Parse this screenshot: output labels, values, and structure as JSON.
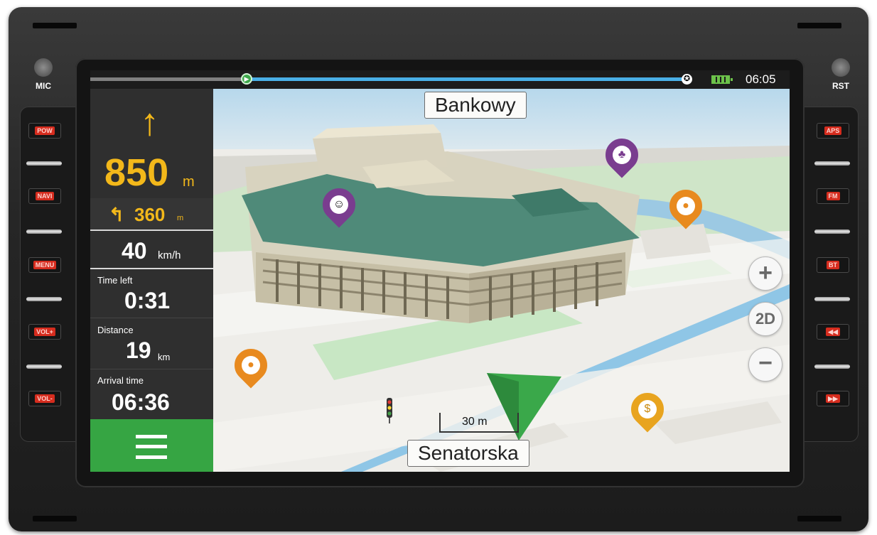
{
  "device": {
    "left_top_label": "MIC",
    "right_top_label": "RST",
    "left_buttons": [
      "POW",
      "NAVI",
      "MENU",
      "VOL+",
      "VOL-"
    ],
    "right_buttons": [
      "APS",
      "FM",
      "BT",
      "◀◀",
      "▶▶"
    ]
  },
  "status": {
    "time": "06:05",
    "route_progress_percent": 26
  },
  "maneuver": {
    "distance_value": "850",
    "distance_unit": "m",
    "next_distance_value": "360",
    "next_distance_unit": "m",
    "speed_value": "40",
    "speed_unit": "km/h"
  },
  "stats": {
    "time_left_label": "Time left",
    "time_left_value": "0:31",
    "distance_label": "Distance",
    "distance_value": "19",
    "distance_unit": "km",
    "arrival_label": "Arrival time",
    "arrival_value": "06:36"
  },
  "map": {
    "top_street": "Bankowy",
    "bottom_street": "Senatorska",
    "scale_label": "30 m",
    "view_mode": "2D",
    "pins": [
      "theater",
      "park",
      "restaurant",
      "restaurant",
      "bank"
    ]
  },
  "icons": {
    "zoom_in": "+",
    "zoom_out": "−",
    "straight": "↑",
    "turn_left": "↰",
    "start": "▶",
    "finish": "✪"
  },
  "colors": {
    "accent_yellow": "#f3b81a",
    "menu_green": "#36a543",
    "route_blue": "#4ab0e8",
    "pin_orange": "#e88a1f",
    "pin_purple": "#7a3d8f",
    "hw_red": "#d62c1e"
  }
}
